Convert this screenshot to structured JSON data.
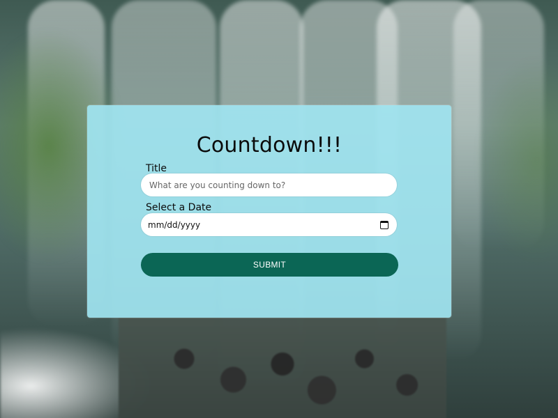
{
  "form": {
    "heading": "Countdown!!!",
    "title_label": "Title",
    "title_placeholder": "What are you counting down to?",
    "date_label": "Select a Date",
    "date_value": "mm/dd/yyyy",
    "submit_label": "SUBMIT"
  },
  "colors": {
    "card_background": "#a0e4f0",
    "submit_background": "#0b6655"
  },
  "icons": {
    "calendar": "calendar-icon"
  }
}
